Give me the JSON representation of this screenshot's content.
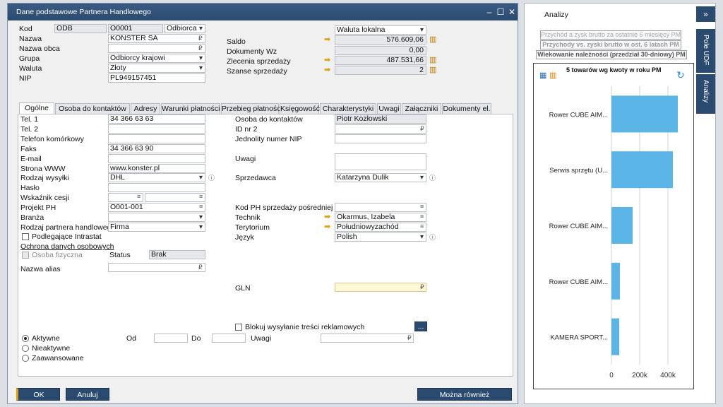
{
  "window": {
    "title": "Dane podstawowe Partnera Handlowego",
    "minimize": "‒",
    "maximize": "☐",
    "close": "✕"
  },
  "header": {
    "kod_label": "Kod",
    "kod_series": "ODB",
    "kod_value": "O0001",
    "kod_type": "Odbiorca",
    "nazwa_label": "Nazwa",
    "nazwa_value": "KONSTER SA",
    "nazwa_obca_label": "Nazwa obca",
    "grupa_label": "Grupa",
    "grupa_value": "Odbiorcy krajowi",
    "waluta_label": "Waluta",
    "waluta_value": "Złoty",
    "nip_label": "NIP",
    "nip_value": "PL949157451"
  },
  "balances": {
    "currency_mode": "Waluta lokalna",
    "saldo_label": "Saldo",
    "saldo_value": "576.609,06",
    "dokumenty_label": "Dokumenty Wz",
    "dokumenty_value": "0,00",
    "zlecenia_label": "Zlecenia sprzedaży",
    "zlecenia_value": "487.531,66",
    "szanse_label": "Szanse sprzedaży",
    "szanse_value": "2"
  },
  "tabs": [
    "Ogólne",
    "Osoba do kontaktów",
    "Adresy",
    "Warunki płatności",
    "Przebieg płatności",
    "Księgowość",
    "Charakterystyki",
    "Uwagi",
    "Załączniki",
    "Dokumenty el."
  ],
  "general": {
    "tel1_label": "Tel. 1",
    "tel1_value": "34 366 63 63",
    "tel2_label": "Tel. 2",
    "telkom_label": "Telefon komórkowy",
    "faks_label": "Faks",
    "faks_value": "34 366 63 90",
    "email_label": "E-mail",
    "www_label": "Strona WWW",
    "www_value": "www.konster.pl",
    "wysylka_label": "Rodzaj wysyłki",
    "wysylka_value": "DHL",
    "haslo_label": "Hasło",
    "wskaznik_label": "Wskaźnik cesji",
    "projekt_label": "Projekt PH",
    "projekt_value": "O001-001",
    "branza_label": "Branża",
    "rodzaj_label": "Rodzaj partnera handlowego",
    "rodzaj_value": "Firma",
    "intrastat_label": "Podlegające Intrastat",
    "ochrona_label": "Ochrona danych osobowych",
    "osoba_fiz_label": "Osoba fizyczna",
    "status_label": "Status",
    "status_value": "Brak",
    "alias_label": "Nazwa alias",
    "osoba_kontakt_label": "Osoba do kontaktów",
    "osoba_kontakt_value": "Piotr Kozłowski",
    "id2_label": "ID nr 2",
    "jnip_label": "Jednolity numer NIP",
    "uwagi_label": "Uwagi",
    "sprzedawca_label": "Sprzedawca",
    "sprzedawca_value": "Katarzyna Dulik",
    "kodph_label": "Kod PH sprzedaży pośredniej",
    "technik_label": "Technik",
    "technik_value": "Okarmus, Izabela",
    "terytorium_label": "Terytorium",
    "terytorium_value": "Południowyzachód",
    "jezyk_label": "Język",
    "jezyk_value": "Polish",
    "gln_label": "GLN",
    "blokuj_label": "Blokuj wysyłanie treści reklamowych",
    "more_btn": "...",
    "aktywne": "Aktywne",
    "nieaktywne": "Nieaktywne",
    "zaawansowane": "Zaawansowane",
    "od_label": "Od",
    "do_label": "Do",
    "uwagi2_label": "Uwagi"
  },
  "buttons": {
    "ok": "OK",
    "cancel": "Anuluj",
    "mozna": "Można również"
  },
  "right_panel": {
    "title": "Analizy",
    "side_tab1": "Pole UDF",
    "side_tab2": "Analizy",
    "reports": [
      "Przychód a zysk brutto za ostatnie 6 miesięcy PM",
      "Przychody vs. zyski brutto w ost. 6 latach PM",
      "Wiekowanie należności (przedział 30-dniowy) PM"
    ],
    "colors": {
      "bar": "#5ab4e5",
      "nav": "#2b4a70"
    }
  },
  "chart_data": {
    "type": "bar",
    "orientation": "horizontal",
    "title": "5 towarów wg kwoty w roku PM",
    "categories": [
      "Rower CUBE AIM...",
      "Serwis sprzętu (U...",
      "Rower CUBE AIM...",
      "Rower CUBE AIM...",
      "KAMERA SPORT..."
    ],
    "values": [
      470000,
      435000,
      150000,
      60000,
      55000
    ],
    "xlim": [
      0,
      500000
    ],
    "xticks": [
      "0",
      "200k",
      "400k"
    ],
    "tick_values": [
      0,
      200000,
      400000
    ],
    "grid": true
  }
}
